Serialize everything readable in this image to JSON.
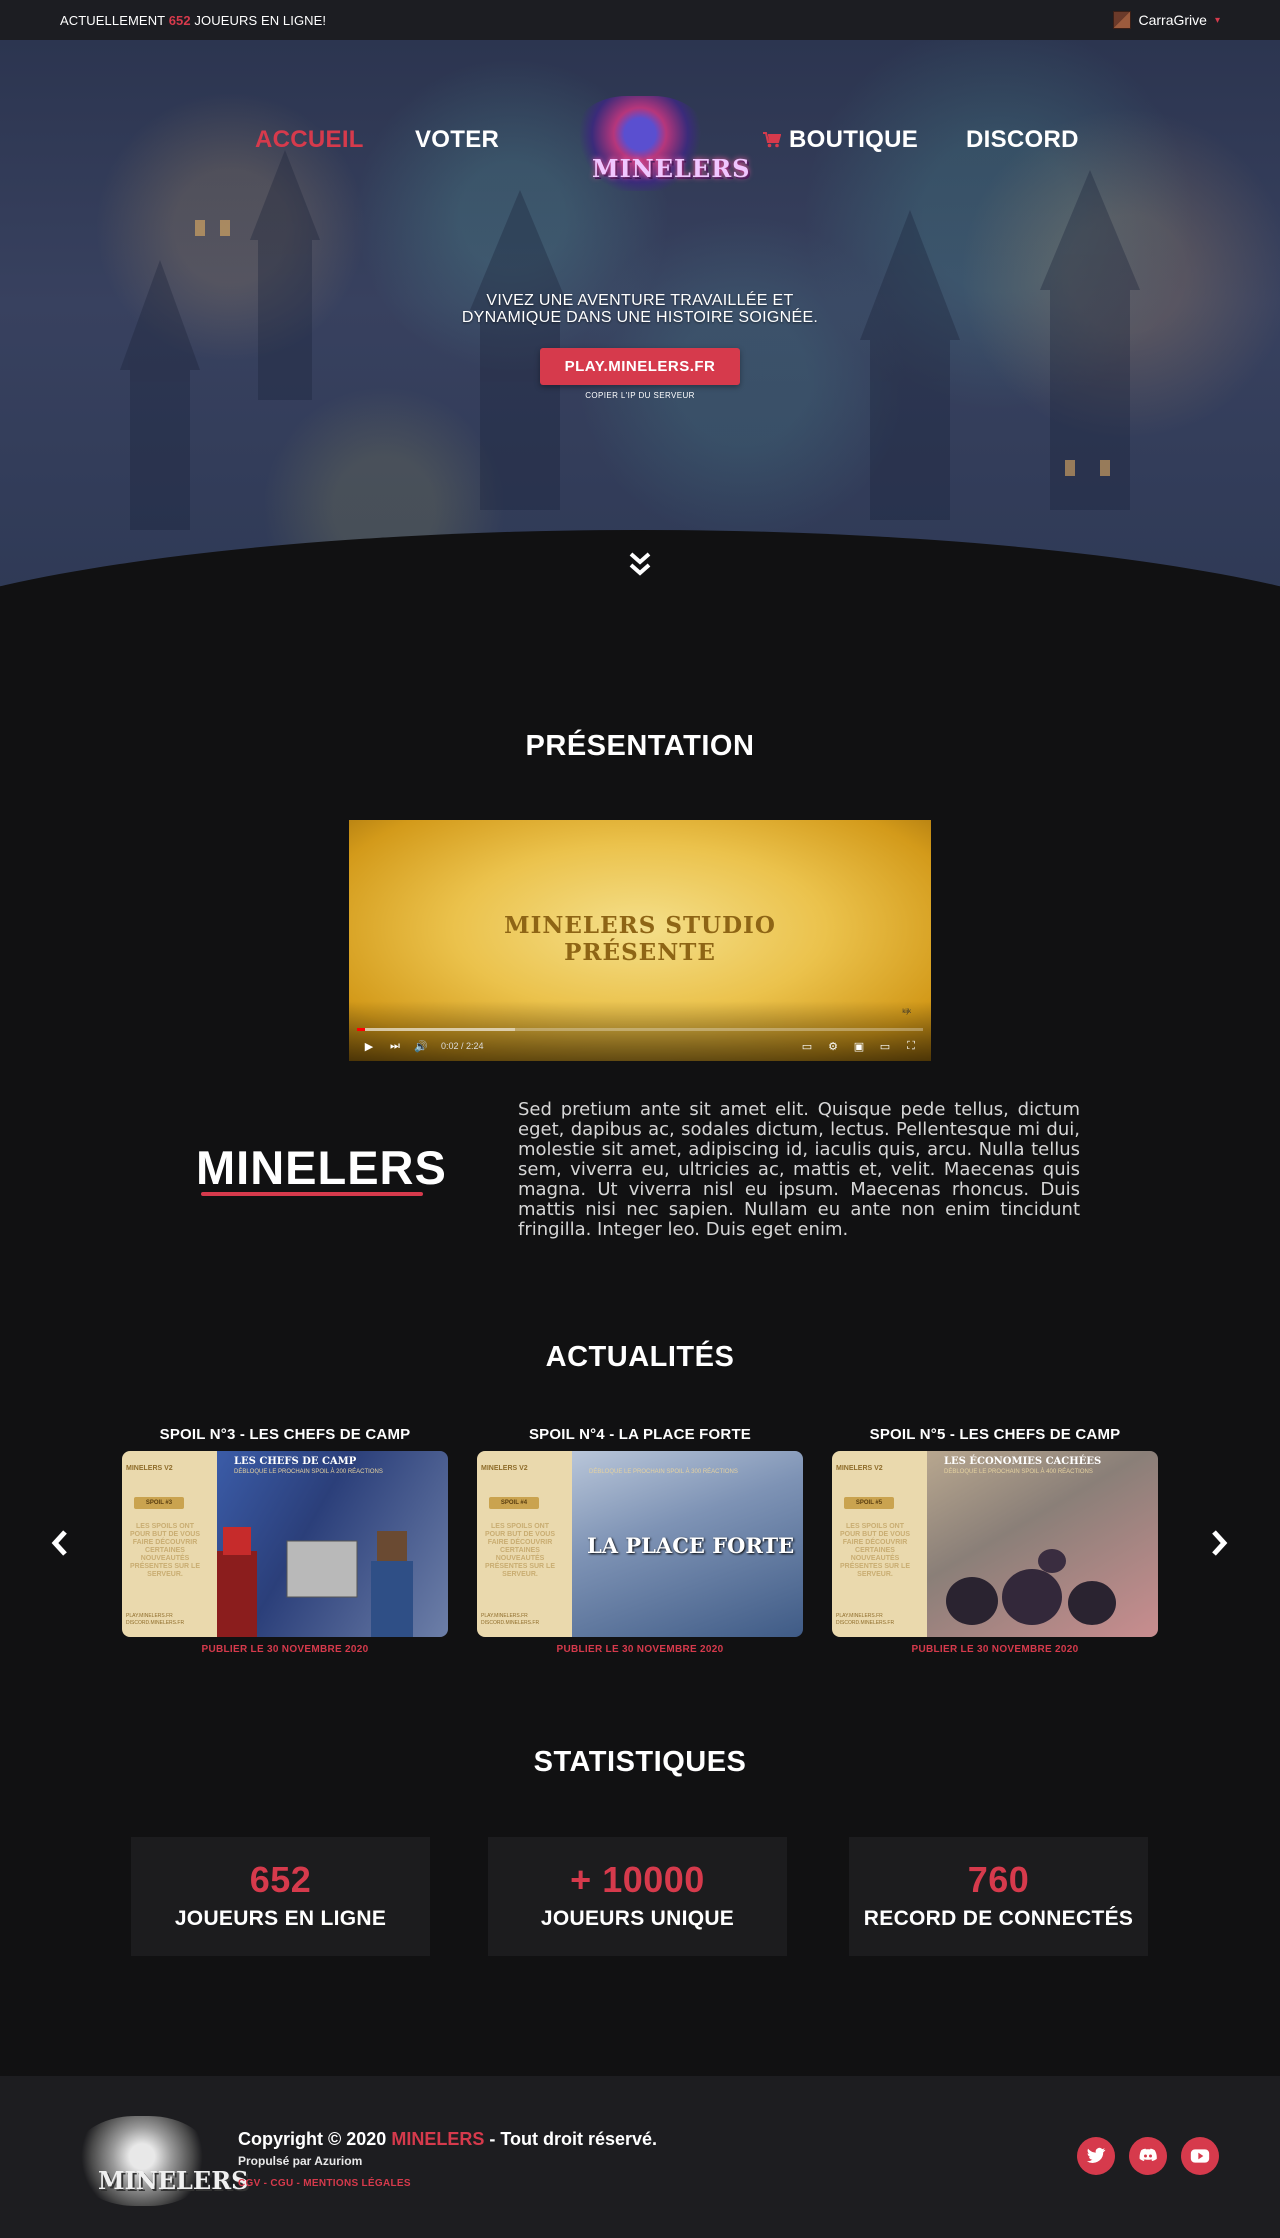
{
  "topbar": {
    "online_prefix": "ACTUELLEMENT",
    "online_count": "652",
    "online_suffix": "JOUEURS EN LIGNE!",
    "username": "CarraGrive",
    "caret": "▾"
  },
  "nav": {
    "home": "ACCUEIL",
    "vote": "VOTER",
    "logo_text": "MINELERS",
    "shop": "BOUTIQUE",
    "discord": "DISCORD",
    "active": "home"
  },
  "hero": {
    "tagline_line1": "VIVEZ UNE AVENTURE TRAVAILLÉE ET",
    "tagline_line2": "DYNAMIQUE DANS UNE HISTOIRE SOIGNÉE.",
    "ip_button": "PLAY.MINELERS.FR",
    "ip_hint": "COPIER L'IP DU SERVEUR"
  },
  "presentation": {
    "title": "PRÉSENTATION",
    "video": {
      "text_line1": "MINELERS STUDIO",
      "text_line2": "PRÉSENTE",
      "time": "0:02 / 2:24",
      "progress_played": 0.014,
      "watermark": "kijk"
    },
    "brand": "MINELERS",
    "description": "Sed pretium ante sit amet elit. Quisque pede tellus, dictum eget, dapibus ac, sodales dictum, lectus. Pellentesque mi dui, molestie sit amet, adipiscing id, iaculis quis, arcu. Nulla tellus sem, viverra eu, ultricies ac, mattis et, velit. Maecenas quis magna. Ut viverra nisl eu ipsum. Maecenas rhoncus. Duis mattis nisi nec sapien. Nullam eu ante non enim tincidunt fringilla. Integer leo. Duis eget enim."
  },
  "news": {
    "title": "ACTUALITÉS",
    "prev_icon": "chevron-left-icon",
    "next_icon": "chevron-right-icon",
    "posts": [
      {
        "title": "SPOIL N°3 - LES CHEFS DE CAMP",
        "date": "PUBLIER LE 30 NOVEMBRE 2020",
        "image_side_top": "MINELERS V2",
        "image_tag": "SPOIL #3",
        "image_side_text": "LES SPOILS ONT POUR BUT DE VOUS FAIRE DÉCOUVRIR CERTAINES NOUVEAUTÉS PRÉSENTES SUR LE SERVEUR.",
        "image_side_bottom": "PLAY.MINELERS.FR DISCORD.MINELERS.FR",
        "image_heading": "LES CHEFS DE CAMP",
        "image_sub": "DÉBLOQUE LE PROCHAIN SPOIL À 200 RÉACTIONS",
        "image_big": "",
        "bg": "linear-gradient(120deg,#3b5ca8 0%,#2b3f7a 40%,#6d7fa8 100%)"
      },
      {
        "title": "SPOIL N°4 - LA PLACE FORTE",
        "date": "PUBLIER LE 30 NOVEMBRE 2020",
        "image_side_top": "MINELERS V2",
        "image_tag": "SPOIL #4",
        "image_side_text": "LES SPOILS ONT POUR BUT DE VOUS FAIRE DÉCOUVRIR CERTAINES NOUVEAUTÉS PRÉSENTES SUR LE SERVEUR.",
        "image_side_bottom": "PLAY.MINELERS.FR DISCORD.MINELERS.FR",
        "image_heading": "",
        "image_sub": "DÉBLOQUE LE PROCHAIN SPOIL À 300 RÉACTIONS",
        "image_big": "LA PLACE FORTE",
        "bg": "linear-gradient(160deg,#b9c6d9 0%,#7e93b5 40%,#3f5b86 100%)"
      },
      {
        "title": "SPOIL N°5 - LES CHEFS DE CAMP",
        "date": "PUBLIER LE 30 NOVEMBRE 2020",
        "image_side_top": "MINELERS V2",
        "image_tag": "SPOIL #5",
        "image_side_text": "LES SPOILS ONT POUR BUT DE VOUS FAIRE DÉCOUVRIR CERTAINES NOUVEAUTÉS PRÉSENTES SUR LE SERVEUR.",
        "image_side_bottom": "PLAY.MINELERS.FR DISCORD.MINELERS.FR",
        "image_heading": "LES ÉCONOMIES CACHÉES",
        "image_sub": "DÉBLOQUE LE PROCHAIN SPOIL À 400 RÉACTIONS",
        "image_big": "",
        "bg": "linear-gradient(150deg,#b8a78f 0%,#8a7f78 40%,#c98d8f 100%)"
      }
    ]
  },
  "stats": {
    "title": "STATISTIQUES",
    "items": [
      {
        "value": "652",
        "label": "JOUEURS EN LIGNE"
      },
      {
        "value": "+ 10000",
        "label": "JOUEURS UNIQUE"
      },
      {
        "value": "760",
        "label": "RECORD DE CONNECTÉS"
      }
    ]
  },
  "footer": {
    "logo_text": "MINELERS",
    "copyright_prefix": "Copyright © 2020",
    "copyright_brand": "MINELERS",
    "copyright_suffix": "- Tout droit réservé.",
    "powered": "Propulsé par Azuriom",
    "legal": "CGV - CGU - MENTIONS LÉGALES",
    "social": [
      "twitter-icon",
      "discord-icon",
      "youtube-icon"
    ]
  },
  "colors": {
    "accent": "#d63a4c",
    "background": "#111112",
    "panel": "#1c1c1e"
  }
}
